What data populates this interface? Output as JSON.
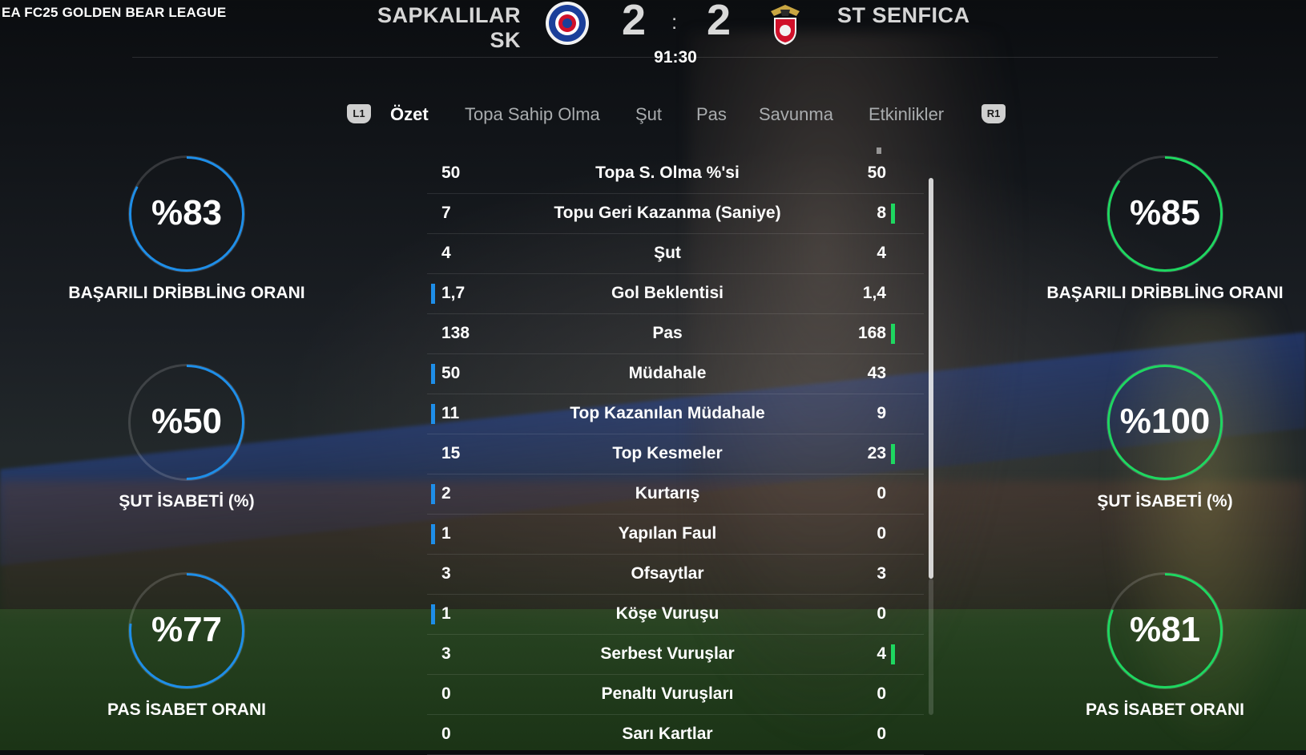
{
  "league": "EA FC25 GOLDEN BEAR LEAGUE",
  "scoreboard": {
    "home_team": "SAPKALILAR SK",
    "away_team": "ST SENFICA",
    "home_score": "2",
    "separator": ":",
    "away_score": "2",
    "clock": "91:30",
    "home_color": "#1e8ee8",
    "away_color": "#1ed760"
  },
  "tabs": {
    "left_button": "L1",
    "right_button": "R1",
    "items": [
      "Özet",
      "Topa Sahip Olma",
      "Şut",
      "Pas",
      "Savunma",
      "Etkinlikler"
    ],
    "active": "Özet"
  },
  "stats": [
    {
      "label": "Topa S. Olma %'si",
      "home": "50",
      "away": "50",
      "leader": "none"
    },
    {
      "label": "Topu Geri Kazanma (Saniye)",
      "home": "7",
      "away": "8",
      "leader": "away"
    },
    {
      "label": "Şut",
      "home": "4",
      "away": "4",
      "leader": "none"
    },
    {
      "label": "Gol Beklentisi",
      "home": "1,7",
      "away": "1,4",
      "leader": "home"
    },
    {
      "label": "Pas",
      "home": "138",
      "away": "168",
      "leader": "away"
    },
    {
      "label": "Müdahale",
      "home": "50",
      "away": "43",
      "leader": "home"
    },
    {
      "label": "Top Kazanılan Müdahale",
      "home": "11",
      "away": "9",
      "leader": "home"
    },
    {
      "label": "Top Kesmeler",
      "home": "15",
      "away": "23",
      "leader": "away"
    },
    {
      "label": "Kurtarış",
      "home": "2",
      "away": "0",
      "leader": "home"
    },
    {
      "label": "Yapılan Faul",
      "home": "1",
      "away": "0",
      "leader": "home"
    },
    {
      "label": "Ofsaytlar",
      "home": "3",
      "away": "3",
      "leader": "none"
    },
    {
      "label": "Köşe Vuruşu",
      "home": "1",
      "away": "0",
      "leader": "home"
    },
    {
      "label": "Serbest Vuruşlar",
      "home": "3",
      "away": "4",
      "leader": "away"
    },
    {
      "label": "Penaltı Vuruşları",
      "home": "0",
      "away": "0",
      "leader": "none"
    },
    {
      "label": "Sarı Kartlar",
      "home": "0",
      "away": "0",
      "leader": "none"
    }
  ],
  "rings": {
    "home": [
      {
        "value": "%83",
        "percent": 83,
        "label": "BAŞARILI DRİBBLİNG ORANI"
      },
      {
        "value": "%50",
        "percent": 50,
        "label": "ŞUT İSABETİ (%)"
      },
      {
        "value": "%77",
        "percent": 77,
        "label": "PAS İSABET ORANI"
      }
    ],
    "away": [
      {
        "value": "%85",
        "percent": 85,
        "label": "BAŞARILI DRİBBLİNG ORANI"
      },
      {
        "value": "%100",
        "percent": 100,
        "label": "ŞUT İSABETİ (%)"
      },
      {
        "value": "%81",
        "percent": 81,
        "label": "PAS İSABET ORANI"
      }
    ]
  },
  "icons": {
    "home_crest": "rangers-crest-icon",
    "away_crest": "benfica-eagle-crest-icon"
  }
}
